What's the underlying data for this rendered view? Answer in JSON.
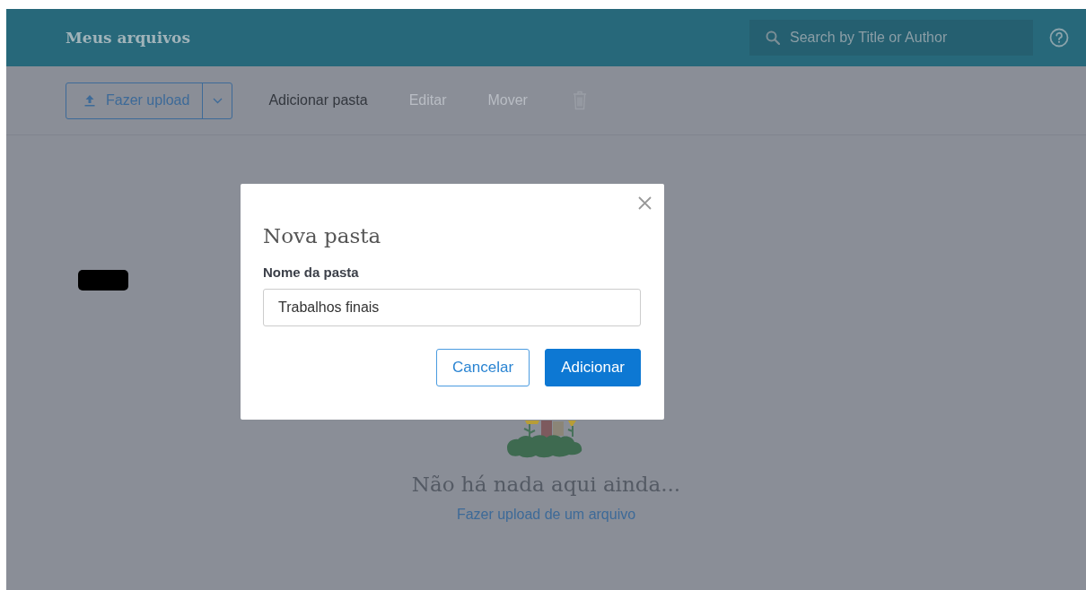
{
  "header": {
    "title": "Meus arquivos",
    "search": {
      "placeholder": "Search by Title or Author"
    }
  },
  "toolbar": {
    "upload_button": "Fazer upload",
    "actions": [
      {
        "label": "Adicionar pasta",
        "disabled": false
      },
      {
        "label": "Editar",
        "disabled": true
      },
      {
        "label": "Mover",
        "disabled": true
      }
    ],
    "delete_disabled": true
  },
  "empty_state": {
    "message": "Não há nada aqui ainda...",
    "link": "Fazer upload de um arquivo"
  },
  "dialog": {
    "title": "Nova pasta",
    "field_label": "Nome da pasta",
    "field_value": "Trabalhos finais",
    "buttons": [
      {
        "label": "Cancelar",
        "kind": "secondary"
      },
      {
        "label": "Adicionar",
        "kind": "primary"
      }
    ]
  }
}
